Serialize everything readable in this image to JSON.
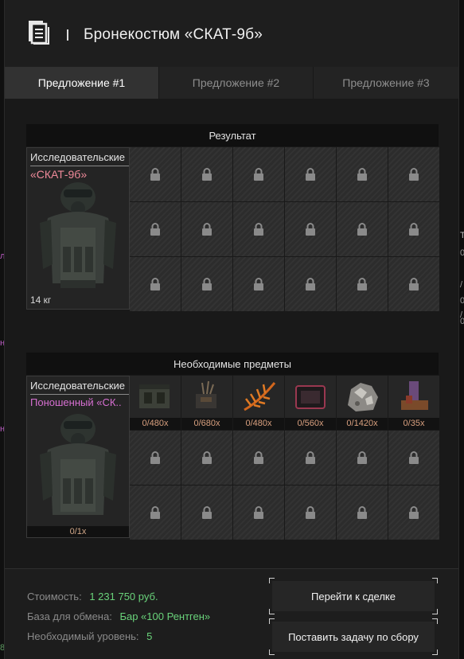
{
  "window": {
    "title": "Бронекостюм «СКАТ-9б»",
    "icon": "document-icon"
  },
  "tabs": [
    {
      "label": "Предложение #1",
      "active": true
    },
    {
      "label": "Предложение #2",
      "active": false
    },
    {
      "label": "Предложение #3",
      "active": false
    }
  ],
  "result": {
    "header": "Результат",
    "item": {
      "category": "Исследовательские",
      "name": "«СКАТ-9б»",
      "name_color": "#f08a9a",
      "weight": "14 кг"
    },
    "locked_slots": 18
  },
  "required": {
    "header": "Необходимые предметы",
    "item": {
      "category": "Исследовательские",
      "name": "Поношенный «СК..",
      "name_color": "#d66fd1",
      "count": "0/1x"
    },
    "components": [
      {
        "count": "0/480x",
        "icon": "ammo-box-icon"
      },
      {
        "count": "0/680x",
        "icon": "electronic-part-icon"
      },
      {
        "count": "0/480x",
        "icon": "fern-plant-icon"
      },
      {
        "count": "0/560x",
        "icon": "red-tablet-icon"
      },
      {
        "count": "0/1420x",
        "icon": "mineral-chunk-icon"
      },
      {
        "count": "0/35x",
        "icon": "artifact-scrap-icon"
      }
    ],
    "locked_slots": 12
  },
  "footer": {
    "cost_label": "Стоимость:",
    "cost_value": "1 231 750 руб.",
    "base_label": "База для обмена:",
    "base_value": "Бар «100 Рентген»",
    "level_label": "Необходимый уровень:",
    "level_value": "5",
    "value_color": "#69d27a",
    "go_to_deal": "Перейти к сделке",
    "set_task": "Поставить задачу по сбору"
  },
  "edge_marks": {
    "left": [
      "л",
      "н",
      "н",
      "8"
    ],
    "right": [
      "Т",
      "0",
      "/",
      "0",
      "/",
      "0"
    ]
  }
}
